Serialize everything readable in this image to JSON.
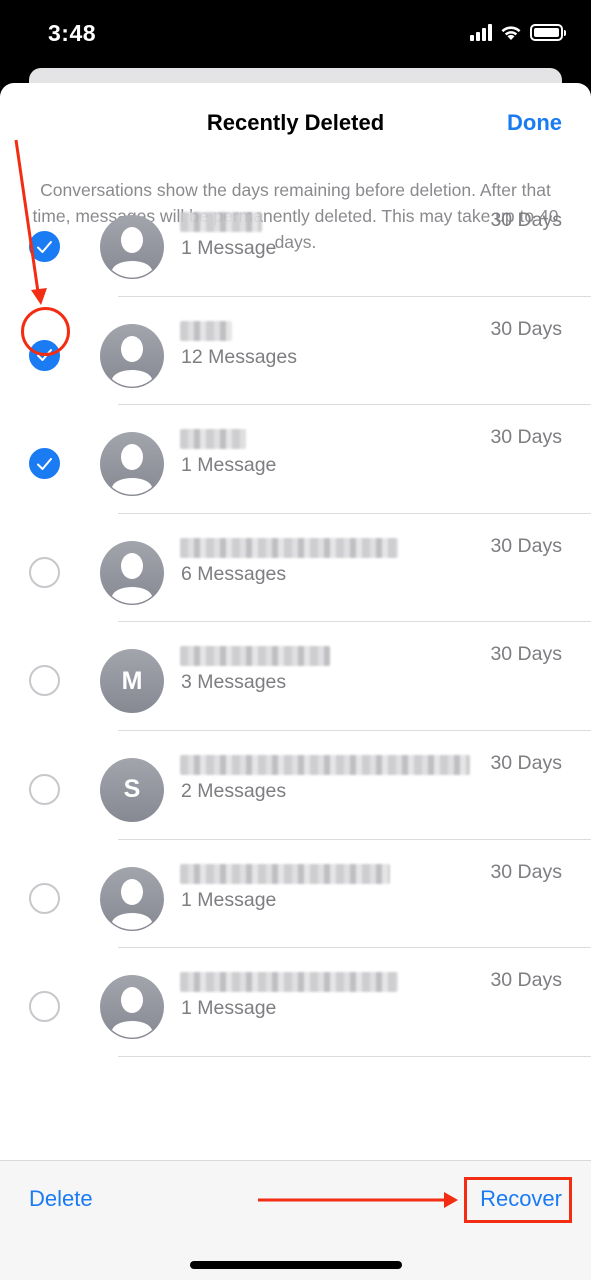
{
  "status_bar": {
    "time": "3:48",
    "icons": [
      "cellular-signal-icon",
      "wifi-icon",
      "battery-icon"
    ]
  },
  "nav": {
    "title": "Recently Deleted",
    "done_label": "Done"
  },
  "info_text": "Conversations show the days remaining before deletion. After that time, messages will be permanently deleted. This may take up to 40 days.",
  "conversations": [
    {
      "name": "[blurred]",
      "count": "1 Message",
      "days": "30 Days",
      "selected": true,
      "avatar": "person-icon",
      "initial": ""
    },
    {
      "name": "[blurred]",
      "count": "12 Messages",
      "days": "30 Days",
      "selected": true,
      "avatar": "person-icon",
      "initial": ""
    },
    {
      "name": "[blurred]",
      "count": "1 Message",
      "days": "30 Days",
      "selected": true,
      "avatar": "person-icon",
      "initial": ""
    },
    {
      "name": "[blurred]",
      "count": "6 Messages",
      "days": "30 Days",
      "selected": false,
      "avatar": "person-icon",
      "initial": ""
    },
    {
      "name": "[blurred]",
      "count": "3 Messages",
      "days": "30 Days",
      "selected": false,
      "avatar": "initial",
      "initial": "M"
    },
    {
      "name": "[blurred]",
      "count": "2 Messages",
      "days": "30 Days",
      "selected": false,
      "avatar": "initial",
      "initial": "S"
    },
    {
      "name": "[blurred]",
      "count": "1 Message",
      "days": "30 Days",
      "selected": false,
      "avatar": "person-icon",
      "initial": ""
    },
    {
      "name": "[blurred]",
      "count": "1 Message",
      "days": "30 Days",
      "selected": false,
      "avatar": "person-icon",
      "initial": ""
    }
  ],
  "toolbar": {
    "delete_label": "Delete",
    "recover_label": "Recover"
  },
  "colors": {
    "accent": "#1a7bf3",
    "annotation": "#f32d14",
    "secondary_text": "#7d7d82"
  }
}
